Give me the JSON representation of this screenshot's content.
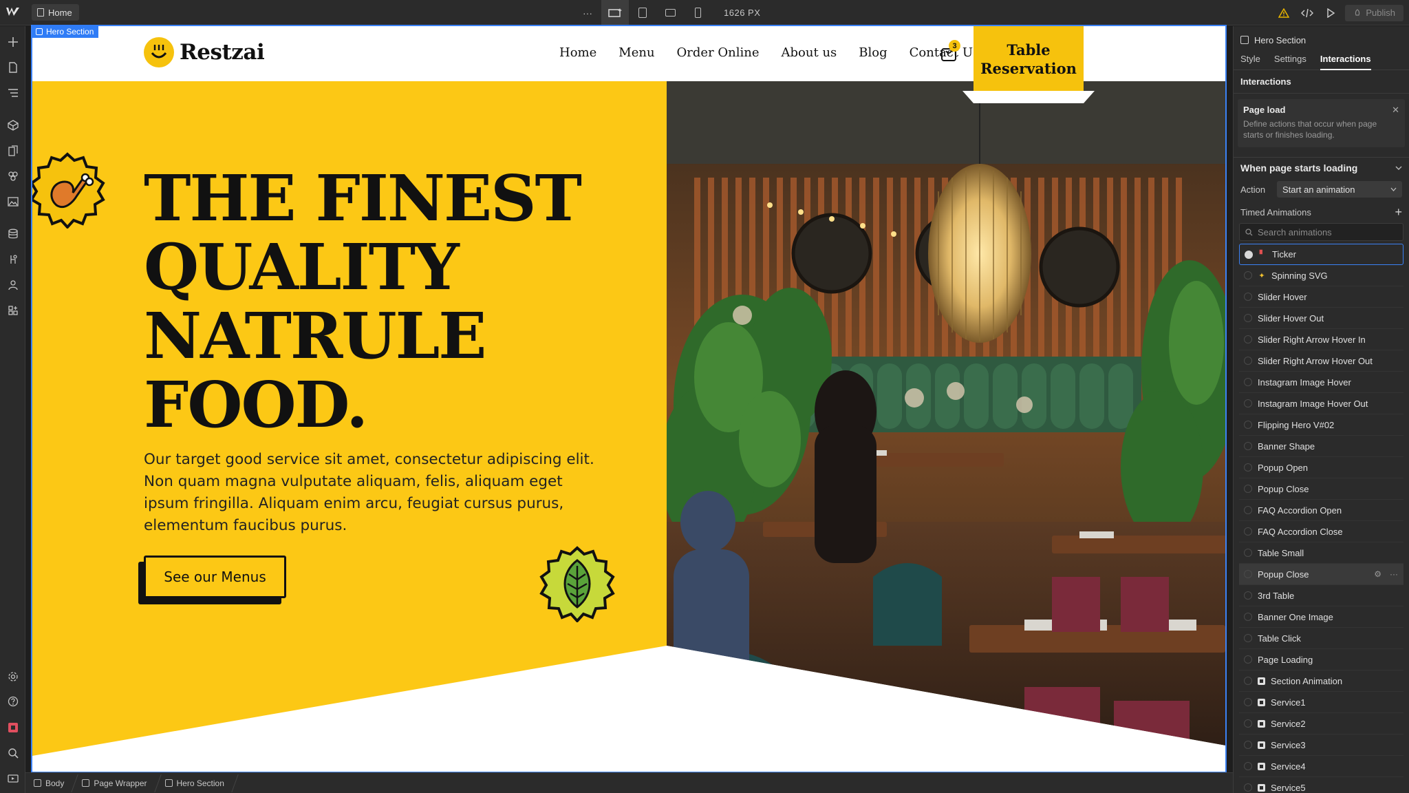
{
  "topbar": {
    "page_name": "Home",
    "more_label": "···",
    "width_readout": "1626 PX",
    "publish_label": "Publish"
  },
  "selection": {
    "tag_label": "Hero Section"
  },
  "site": {
    "brand": "Restzai",
    "nav": [
      "Home",
      "Menu",
      "Order Online",
      "About us",
      "Blog",
      "Contact Us"
    ],
    "cart_count": "3",
    "reserve_line1": "Table",
    "reserve_line2": "Reservation",
    "headline": [
      "THE FINEST",
      "QUALITY",
      "NATRULE",
      "FOOD."
    ],
    "paragraph": "Our target good service sit amet, consectetur adipiscing elit. Non quam magna vulputate aliquam, felis, aliquam eget ipsum fringilla. Aliquam enim arcu, feugiat cursus purus, elementum faucibus purus.",
    "cta_label": "See our Menus",
    "accent_color": "#fcc815"
  },
  "panel": {
    "element_name": "Hero Section",
    "tabs": [
      "Style",
      "Settings",
      "Interactions"
    ],
    "active_tab": "Interactions",
    "section_title": "Interactions",
    "page_load_title": "Page load",
    "page_load_desc": "Define actions that occur when page starts or finishes loading.",
    "when_label": "When page starts loading",
    "action_label": "Action",
    "action_value": "Start an animation",
    "timed_label": "Timed Animations",
    "search_placeholder": "Search animations",
    "animations": [
      {
        "label": "Ticker",
        "icon": "emoji-red"
      },
      {
        "label": "Spinning SVG",
        "icon": "emoji-sparkle"
      },
      {
        "label": "Slider Hover",
        "icon": ""
      },
      {
        "label": "Slider Hover Out",
        "icon": ""
      },
      {
        "label": "Slider Right Arrow Hover In",
        "icon": ""
      },
      {
        "label": "Slider Right Arrow Hover Out",
        "icon": ""
      },
      {
        "label": "Instagram Image Hover",
        "icon": ""
      },
      {
        "label": "Instagram Image Hover Out",
        "icon": ""
      },
      {
        "label": "Flipping Hero V#02",
        "icon": ""
      },
      {
        "label": "Banner Shape",
        "icon": ""
      },
      {
        "label": "Popup Open",
        "icon": ""
      },
      {
        "label": "Popup Close",
        "icon": ""
      },
      {
        "label": "FAQ Accordion Open",
        "icon": ""
      },
      {
        "label": "FAQ Accordion Close",
        "icon": ""
      },
      {
        "label": "Table Small",
        "icon": ""
      },
      {
        "label": "Popup Close",
        "icon": ""
      },
      {
        "label": "3rd Table",
        "icon": ""
      },
      {
        "label": "Banner One Image",
        "icon": ""
      },
      {
        "label": "Table Click",
        "icon": ""
      },
      {
        "label": "Page Loading",
        "icon": ""
      },
      {
        "label": "Section Animation",
        "icon": "square"
      },
      {
        "label": "Service1",
        "icon": "square"
      },
      {
        "label": "Service2",
        "icon": "square"
      },
      {
        "label": "Service3",
        "icon": "square"
      },
      {
        "label": "Service4",
        "icon": "square"
      },
      {
        "label": "Service5",
        "icon": "square"
      }
    ]
  },
  "breadcrumbs": [
    "Body",
    "Page Wrapper",
    "Hero Section"
  ]
}
